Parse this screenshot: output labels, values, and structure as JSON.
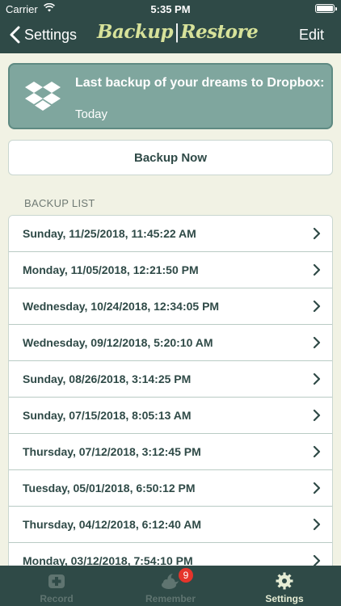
{
  "status_bar": {
    "carrier": "Carrier",
    "time": "5:35 PM"
  },
  "nav": {
    "back_label": "Settings",
    "title_left": "Backup",
    "title_separator": "|",
    "title_right": "Restore",
    "edit_label": "Edit"
  },
  "banner": {
    "line1": "Last backup of your dreams to Dropbox:",
    "line2": "Today",
    "icon": "dropbox-icon"
  },
  "backup_button": {
    "label": "Backup Now"
  },
  "backup_list": {
    "header": "BACKUP LIST",
    "items": [
      {
        "label": "Sunday, 11/25/2018, 11:45:22 AM"
      },
      {
        "label": "Monday, 11/05/2018, 12:21:50 PM"
      },
      {
        "label": "Wednesday, 10/24/2018, 12:34:05 PM"
      },
      {
        "label": "Wednesday, 09/12/2018, 5:20:10 AM"
      },
      {
        "label": "Sunday, 08/26/2018, 3:14:25 PM"
      },
      {
        "label": "Sunday, 07/15/2018, 8:05:13 AM"
      },
      {
        "label": "Thursday, 07/12/2018, 3:12:45 PM"
      },
      {
        "label": "Tuesday, 05/01/2018, 6:50:12 PM"
      },
      {
        "label": "Thursday, 04/12/2018, 6:12:40 AM"
      },
      {
        "label": "Monday, 03/12/2018, 7:54:10 PM"
      }
    ]
  },
  "tab_bar": {
    "tabs": [
      {
        "label": "Record",
        "icon": "medical-cross-icon",
        "active": false
      },
      {
        "label": "Remember",
        "icon": "moon-cloud-icon",
        "active": false,
        "badge": "9"
      },
      {
        "label": "Settings",
        "icon": "gear-icon",
        "active": true
      }
    ]
  },
  "colors": {
    "nav_background": "#2f4a47",
    "title_accent": "#d7e29a",
    "banner_background": "#7fa69e",
    "page_background": "#f1f2e4",
    "badge": "#e5342b"
  }
}
